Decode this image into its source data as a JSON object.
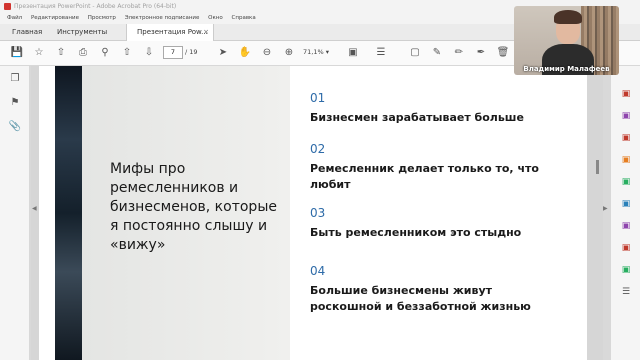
{
  "window": {
    "title": "Презентация PowerPoint - Adobe Acrobat Pro (64-bit)"
  },
  "menu": [
    "Файл",
    "Редактирование",
    "Просмотр",
    "Электронное подписание",
    "Окно",
    "Справка"
  ],
  "tabs": {
    "home": "Главная",
    "tools": "Инструменты",
    "document": "Презентация Pow...",
    "close": "×"
  },
  "toolbar": {
    "current_page": "7",
    "total_pages": "/ 19",
    "zoom": "71,1%"
  },
  "slide": {
    "title": "Мифы про ремесленников и бизнесменов, которые я постоянно слышу и «вижу»",
    "items": [
      {
        "num": "01",
        "text": "Бизнесмен зарабатывает больше"
      },
      {
        "num": "02",
        "text": "Ремесленник делает только то, что любит"
      },
      {
        "num": "03",
        "text": "Быть ремесленником это стыдно"
      },
      {
        "num": "04",
        "text": "Большие бизнесмены живут роскошной и беззаботной жизнью"
      }
    ]
  },
  "video": {
    "participant_name": "Владимир Малафеев"
  },
  "colors": {
    "accent_number": "#2e6ba8",
    "acrobat_red": "#d1342f"
  }
}
